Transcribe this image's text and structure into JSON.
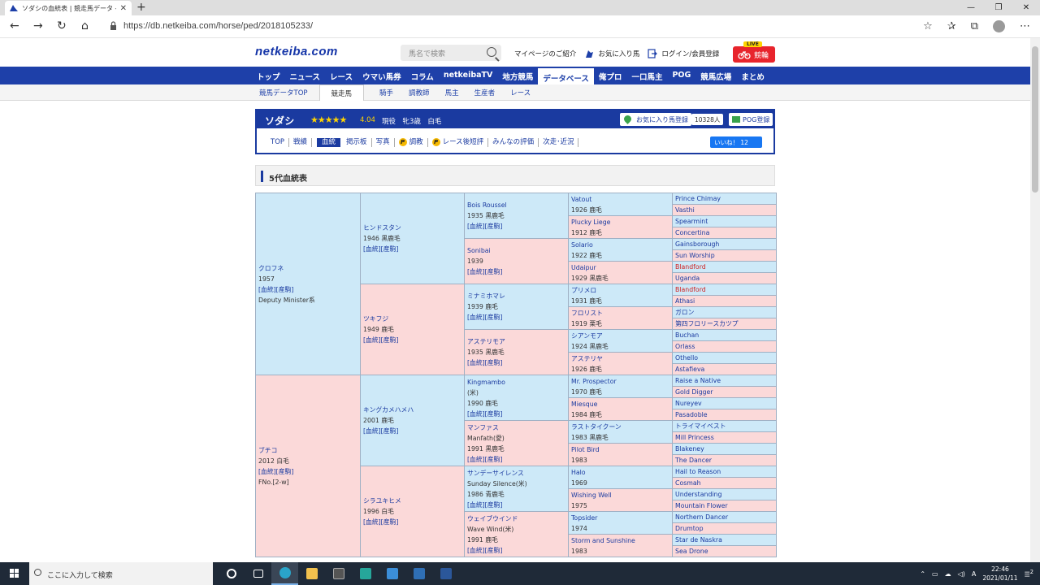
{
  "browser": {
    "tab_title": "ソダシの血統表 | 競走馬データ - ne",
    "tab_close": "✕",
    "new_tab": "+",
    "url": "https://db.netkeiba.com/horse/ped/2018105233/",
    "window_controls": [
      "—",
      "❐",
      "✕"
    ]
  },
  "site": {
    "logo": "netkeiba.com",
    "search_placeholder": "馬名で検索",
    "header_links": [
      "マイページのご紹介",
      "お気に入り馬",
      "ログイン/会員登録"
    ],
    "live_badge": "LIVE",
    "live_label": "競輪",
    "main_nav": [
      "トップ",
      "ニュース",
      "レース",
      "ウマい馬券",
      "コラム",
      "netkeibaTV",
      "地方競馬",
      "データベース",
      "俺プロ",
      "一口馬主",
      "POG",
      "競馬広場",
      "まとめ"
    ],
    "main_nav_active": 7,
    "sub_nav": [
      "競馬データTOP",
      "競走馬",
      "騎手",
      "調教師",
      "馬主",
      "生産者",
      "レース"
    ],
    "sub_nav_active": 1
  },
  "horse": {
    "name": "ソダシ",
    "stars": "★★★★★",
    "rating": "4.04",
    "info": "現役　牝3歳　白毛",
    "fav_button": "お気に入り馬登録",
    "fav_count": "10328人",
    "pog_button": "POG登録",
    "tabs": [
      "TOP",
      "戦績",
      "血統",
      "掲示板",
      "写真",
      "調教",
      "レース後短評",
      "みんなの評価",
      "次走･近況"
    ],
    "active_tab": 2,
    "paid_tabs": [
      5,
      6
    ],
    "like_label": "いいね！ 12"
  },
  "section_title": "5代血統表",
  "pedigree": {
    "link_text": "[血統][産駒]",
    "gen1": [
      {
        "name": "クロフネ",
        "lines": [
          "1957"
        ],
        "extra": "Deputy Minister系",
        "sex": "m"
      },
      {
        "name": "ブチコ",
        "lines": [
          "2012 白毛"
        ],
        "extra": "FNo.[2-w]",
        "sex": "f"
      }
    ],
    "gen2": [
      {
        "name": "ヒンドスタン",
        "lines": [
          "1946 黒鹿毛"
        ],
        "sex": "m"
      },
      {
        "name": "ツキフジ",
        "lines": [
          "1949 鹿毛"
        ],
        "sex": "f"
      },
      {
        "name": "キングカメハメハ",
        "lines": [
          "2001 鹿毛"
        ],
        "sex": "m"
      },
      {
        "name": "シラユキヒメ",
        "lines": [
          "1996 白毛"
        ],
        "sex": "f"
      }
    ],
    "gen3": [
      {
        "name": "Bois Roussel",
        "lines": [
          "1935 黒鹿毛"
        ],
        "sex": "m"
      },
      {
        "name": "Sonibai",
        "lines": [
          "1939"
        ],
        "sex": "f"
      },
      {
        "name": "ミナミホマレ",
        "lines": [
          "1939 鹿毛"
        ],
        "sex": "m"
      },
      {
        "name": "アステリモア",
        "lines": [
          "1935 黒鹿毛"
        ],
        "sex": "f"
      },
      {
        "name": "Kingmambo",
        "lines": [
          "(米)",
          "1990 鹿毛"
        ],
        "sex": "m"
      },
      {
        "name": "マンファス",
        "lines": [
          "Manfath(愛)",
          "1991 黒鹿毛"
        ],
        "sex": "f"
      },
      {
        "name": "サンデーサイレンス",
        "lines": [
          "Sunday Silence(米)",
          "1986 青鹿毛"
        ],
        "sex": "m"
      },
      {
        "name": "ウェイブウインド",
        "lines": [
          "Wave Wind(米)",
          "1991 鹿毛"
        ],
        "sex": "f"
      }
    ],
    "gen4": [
      {
        "name": "Vatout",
        "year": "1926 鹿毛",
        "sex": "m"
      },
      {
        "name": "Plucky Liege",
        "year": "1912 鹿毛",
        "sex": "f"
      },
      {
        "name": "Solario",
        "year": "1922 鹿毛",
        "sex": "m"
      },
      {
        "name": "Udaipur",
        "year": "1929 黒鹿毛",
        "sex": "f"
      },
      {
        "name": "プリメロ",
        "year": "1931 鹿毛",
        "sex": "m"
      },
      {
        "name": "フロリスト",
        "year": "1919 栗毛",
        "sex": "f"
      },
      {
        "name": "シアンモア",
        "year": "1924 黒鹿毛",
        "sex": "m"
      },
      {
        "name": "アステリヤ",
        "year": "1926 鹿毛",
        "sex": "f"
      },
      {
        "name": "Mr. Prospector",
        "year": "1970 鹿毛",
        "sex": "m"
      },
      {
        "name": "Miesque",
        "year": "1984 鹿毛",
        "sex": "f"
      },
      {
        "name": "ラストタイクーン",
        "year": "1983 黒鹿毛",
        "sex": "m"
      },
      {
        "name": "Pilot Bird",
        "year": "1983",
        "sex": "f"
      },
      {
        "name": "Halo",
        "year": "1969",
        "sex": "m"
      },
      {
        "name": "Wishing Well",
        "year": "1975",
        "sex": "f"
      },
      {
        "name": "Topsider",
        "year": "1974",
        "sex": "m"
      },
      {
        "name": "Storm and Sunshine",
        "year": "1983",
        "sex": "f"
      }
    ],
    "gen5": [
      {
        "name": "Prince Chimay",
        "sex": "m"
      },
      {
        "name": "Vasthi",
        "sex": "f"
      },
      {
        "name": "Spearmint",
        "sex": "m"
      },
      {
        "name": "Concertina",
        "sex": "f"
      },
      {
        "name": "Gainsborough",
        "sex": "m"
      },
      {
        "name": "Sun Worship",
        "sex": "f"
      },
      {
        "name": "Blandford",
        "sex": "m",
        "red": true
      },
      {
        "name": "Uganda",
        "sex": "f"
      },
      {
        "name": "Blandford",
        "sex": "m",
        "red": true
      },
      {
        "name": "Athasi",
        "sex": "f"
      },
      {
        "name": "ガロン",
        "sex": "m"
      },
      {
        "name": "第四フロリースカツプ",
        "sex": "f"
      },
      {
        "name": "Buchan",
        "sex": "m"
      },
      {
        "name": "Orlass",
        "sex": "f"
      },
      {
        "name": "Othello",
        "sex": "m"
      },
      {
        "name": "Astafieva",
        "sex": "f"
      },
      {
        "name": "Raise a Native",
        "sex": "m"
      },
      {
        "name": "Gold Digger",
        "sex": "f"
      },
      {
        "name": "Nureyev",
        "sex": "m"
      },
      {
        "name": "Pasadoble",
        "sex": "f"
      },
      {
        "name": "トライマイベスト",
        "sex": "m"
      },
      {
        "name": "Mill Princess",
        "sex": "f"
      },
      {
        "name": "Blakeney",
        "sex": "m"
      },
      {
        "name": "The Dancer",
        "sex": "f"
      },
      {
        "name": "Hail to Reason",
        "sex": "m"
      },
      {
        "name": "Cosmah",
        "sex": "f"
      },
      {
        "name": "Understanding",
        "sex": "m"
      },
      {
        "name": "Mountain Flower",
        "sex": "f"
      },
      {
        "name": "Northern Dancer",
        "sex": "m"
      },
      {
        "name": "Drumtop",
        "sex": "f"
      },
      {
        "name": "Star de Naskra",
        "sex": "m"
      },
      {
        "name": "Sea Drone",
        "sex": "f"
      }
    ]
  },
  "taskbar": {
    "search_placeholder": "ここに入力して検索",
    "time": "22:46",
    "date": "2021/01/11",
    "ime": "A",
    "notification_count": "2"
  }
}
